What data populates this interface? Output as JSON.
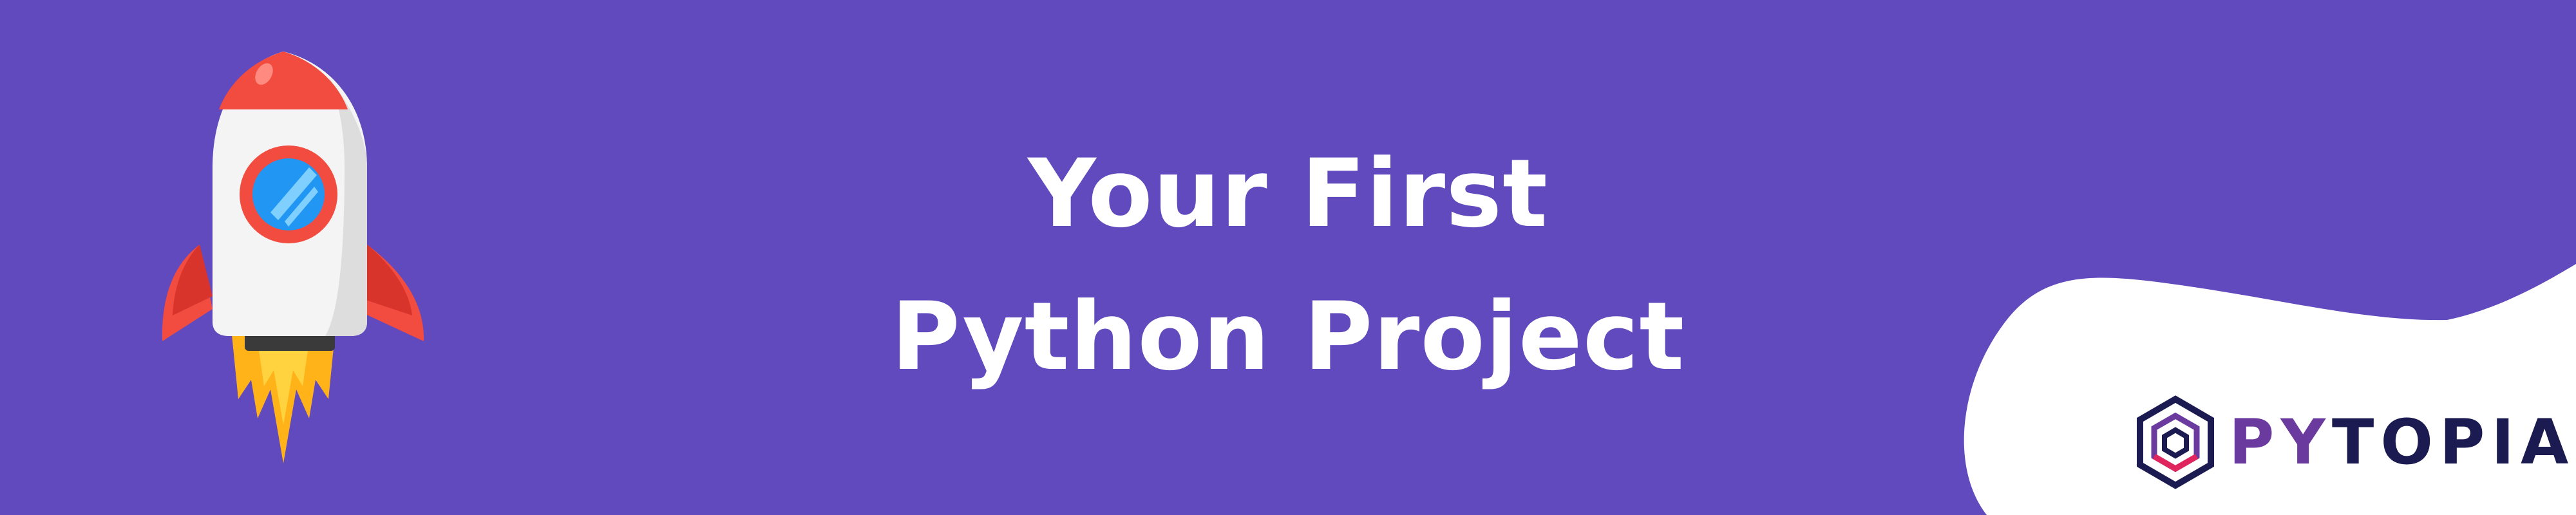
{
  "headline": {
    "line1": "Your First",
    "line2": "Python Project"
  },
  "logo": {
    "wordmark_part1": "PY",
    "wordmark_part2": "TOPIA",
    "icon": "hexagon-logo-icon"
  },
  "illustration": {
    "icon": "rocket-icon"
  },
  "colors": {
    "background": "#6149BE",
    "headline_text": "#FFFFFF",
    "wave": "#FFFFFF",
    "wordmark_primary": "#6B3A9E",
    "wordmark_secondary": "#1B1B52",
    "rocket_red": "#F24B3F",
    "rocket_body": "#F2F2F2",
    "flame": "#FFB319"
  }
}
